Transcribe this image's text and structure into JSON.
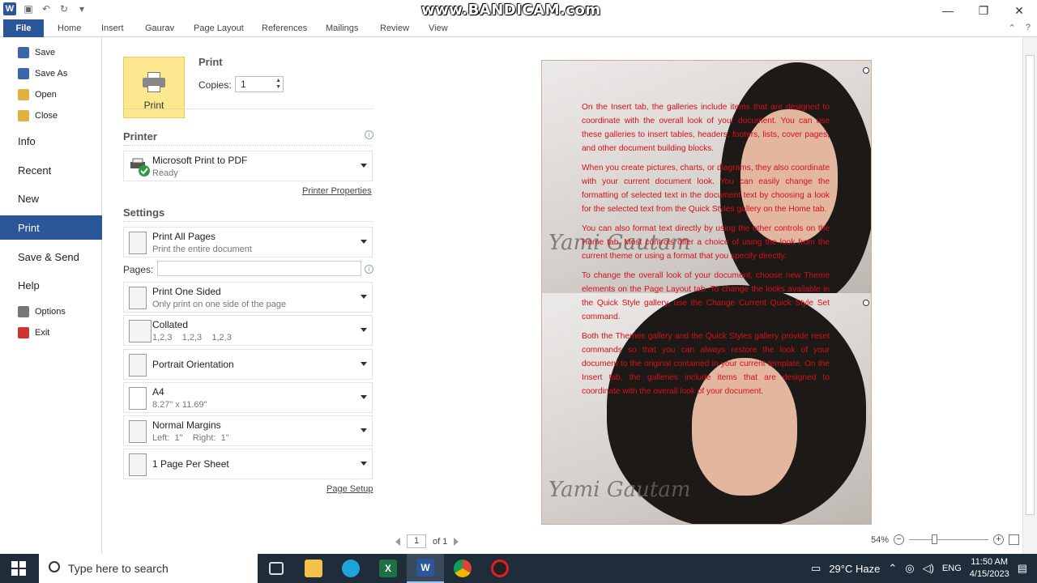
{
  "titlebar": {
    "app_logo": "W",
    "watermark": "www.BANDICAM.com",
    "icons": [
      "save-icon",
      "undo-icon",
      "redo-icon",
      "customize-icon"
    ],
    "controls": [
      "minimize-icon",
      "restore-icon",
      "close-icon"
    ]
  },
  "ribbon": {
    "tabs": [
      "File",
      "Home",
      "Insert",
      "Gaurav",
      "Page Layout",
      "References",
      "Mailings",
      "Review",
      "View"
    ]
  },
  "backstage": {
    "small_items": [
      {
        "label": "Save",
        "icon": "save-icon",
        "color": "#3b66a8"
      },
      {
        "label": "Save As",
        "icon": "save-as-icon",
        "color": "#3b66a8"
      },
      {
        "label": "Open",
        "icon": "folder-icon",
        "color": "#e0b040"
      },
      {
        "label": "Close",
        "icon": "close-doc-icon",
        "color": "#e0b040"
      }
    ],
    "big_items": [
      "Info",
      "Recent",
      "New",
      "Print",
      "Save & Send",
      "Help"
    ],
    "active": "Print",
    "bottom_items": [
      {
        "label": "Options",
        "icon": "options-icon",
        "color": "#777777"
      },
      {
        "label": "Exit",
        "icon": "exit-icon",
        "color": "#cc3333"
      }
    ]
  },
  "print": {
    "button_label": "Print",
    "heading": "Print",
    "copies_label": "Copies:",
    "copies_value": "1",
    "printer_heading": "Printer",
    "printer_name": "Microsoft Print to PDF",
    "printer_status": "Ready",
    "printer_properties": "Printer Properties",
    "settings_heading": "Settings",
    "pages_label": "Pages:",
    "settings": [
      {
        "main": "Print All Pages",
        "sub": "Print the entire document"
      },
      {
        "main": "Print One Sided",
        "sub": "Only print on one side of the page"
      },
      {
        "main": "Collated",
        "sub": "1,2,3    1,2,3    1,2,3"
      },
      {
        "main": "Portrait Orientation",
        "sub": ""
      },
      {
        "main": "A4",
        "sub": "8.27\" x 11.69\""
      },
      {
        "main": "Normal Margins",
        "sub": "Left:  1\"    Right:  1\""
      },
      {
        "main": "1 Page Per Sheet",
        "sub": ""
      }
    ],
    "page_setup": "Page Setup"
  },
  "preview": {
    "paragraphs": [
      "On the Insert tab, the galleries include items that are designed to coordinate with the overall look of your document. You can use these galleries to insert tables, headers, footers, lists, cover pages, and other document building blocks.",
      "When you create pictures, charts, or diagrams, they also coordinate with your current document look. You can easily change the formatting of selected text in the document text by choosing a look for the selected text from the Quick Styles gallery on the Home tab.",
      "You can also format text directly by using the other controls on the Home tab. Most controls offer a choice of using the look from the current theme or using a format that you specify directly.",
      "To change the overall look of your document, choose new Theme elements on the Page Layout tab. To change the looks available in the Quick Style gallery, use the Change Current Quick Style Set command.",
      "Both the Themes gallery and the Quick Styles gallery provide reset commands so that you can always restore the look of your document to the original contained in your current template. On the Insert tab, the galleries include items that are designed to coordinate with the overall look of your document."
    ],
    "signature": "Yami Gautam",
    "text_color": "#d6101a",
    "page_current": "1",
    "page_total": "of 1",
    "zoom": "54%"
  },
  "taskbar": {
    "search_placeholder": "Type here to search",
    "weather": "29°C  Haze",
    "lang": "ENG",
    "time": "11:50 AM",
    "date": "4/15/2023"
  }
}
